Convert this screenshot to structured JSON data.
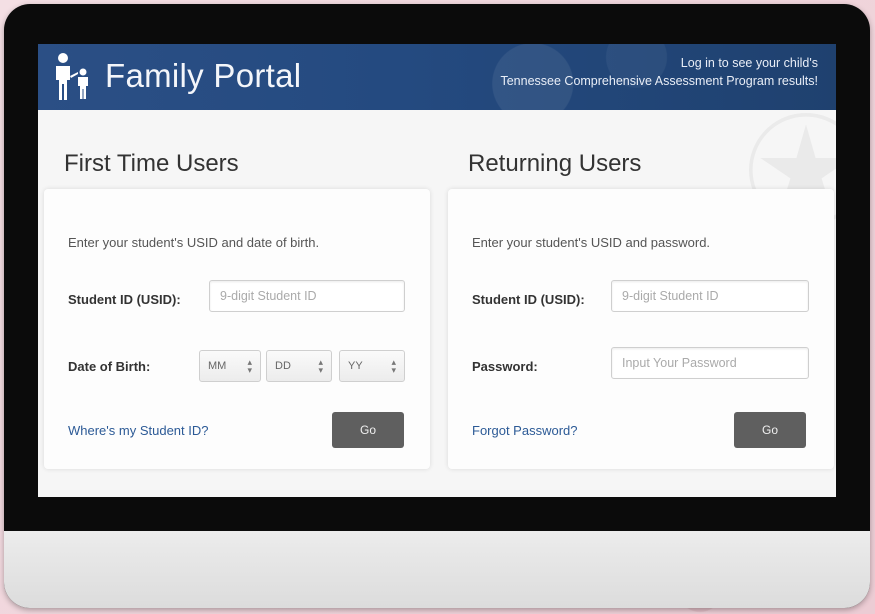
{
  "banner": {
    "title": "Family Portal",
    "tagline_line1": "Log in to see your child's",
    "tagline_line2": "Tennessee Comprehensive Assessment Program results!",
    "logo_icon": "parent-child-icon"
  },
  "first_time": {
    "heading": "First Time Users",
    "instructions": "Enter your student's USID and date of birth.",
    "student_id_label": "Student ID (USID):",
    "student_id_placeholder": "9-digit Student ID",
    "dob_label": "Date of Birth:",
    "month_value": "MM",
    "day_value": "DD",
    "year_value": "YY",
    "help_link": "Where's my Student ID?",
    "go_label": "Go"
  },
  "returning": {
    "heading": "Returning Users",
    "instructions": "Enter your student's USID and password.",
    "student_id_label": "Student ID (USID):",
    "student_id_placeholder": "9-digit Student ID",
    "password_label": "Password:",
    "password_placeholder": "Input Your Password",
    "forgot_link": "Forgot Password?",
    "go_label": "Go"
  },
  "colors": {
    "banner": "#244a80",
    "link": "#2c5a96",
    "button": "#5f5f5f"
  }
}
